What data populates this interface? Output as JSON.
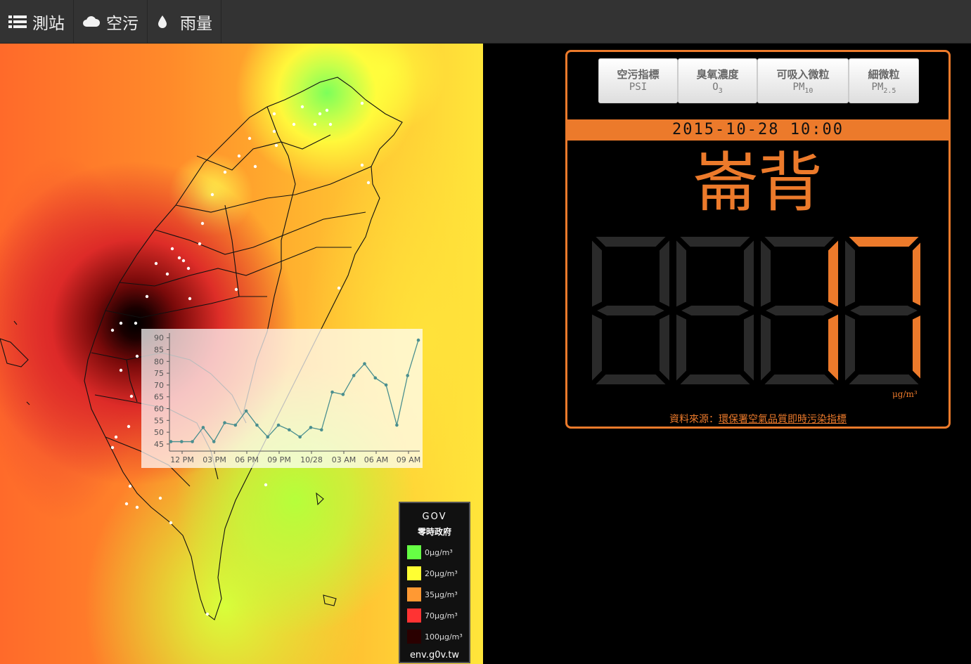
{
  "nav": {
    "items": [
      {
        "label": "測站",
        "icon": "list-icon"
      },
      {
        "label": "空污",
        "icon": "cloud-icon"
      },
      {
        "label": "雨量",
        "icon": "droplet-icon"
      }
    ]
  },
  "panel": {
    "tabs": [
      {
        "title": "空污指標",
        "code": "PSI",
        "sub": ""
      },
      {
        "title": "臭氧濃度",
        "code": "O",
        "sub": "3"
      },
      {
        "title": "可吸入微粒",
        "code": "PM",
        "sub": "10"
      },
      {
        "title": "細微粒",
        "code": "PM",
        "sub": "2.5"
      }
    ],
    "datetime": "2015-10-28 10:00",
    "station_name": "崙背",
    "value": "17",
    "unit": "μg/m³",
    "source_prefix": "資料來源：",
    "source_link": "環保署空氣品質即時污染指標",
    "accent_color": "#ec7a2b"
  },
  "legend": {
    "brand": "GOV",
    "brand_sub": "零時政府",
    "items": [
      {
        "label": "0μg/m³",
        "color": "#66ff44"
      },
      {
        "label": "20μg/m³",
        "color": "#ffff33"
      },
      {
        "label": "35μg/m³",
        "color": "#ff9933"
      },
      {
        "label": "70μg/m³",
        "color": "#ff3333"
      },
      {
        "label": "100μg/m³",
        "color": "#2a0000"
      }
    ],
    "footer": "env.g0v.tw"
  },
  "chart_data": {
    "type": "line",
    "x_ticks": [
      "12 PM",
      "03 PM",
      "06 PM",
      "09 PM",
      "10/28",
      "03 AM",
      "06 AM",
      "09 AM"
    ],
    "y_ticks": [
      45,
      50,
      55,
      60,
      65,
      70,
      75,
      80,
      85,
      90
    ],
    "ylim": [
      42,
      92
    ],
    "x_hours_from_start": [
      0,
      1,
      2,
      3,
      4,
      5,
      6,
      7,
      8,
      9,
      10,
      11,
      12,
      13,
      14,
      15,
      16,
      17,
      18,
      19,
      20,
      21,
      22,
      23,
      24
    ],
    "series": [
      {
        "values": [
          46,
          46,
          46,
          52,
          46,
          54,
          53,
          59,
          53,
          48,
          53,
          51,
          48,
          52,
          51,
          67,
          66,
          74,
          79,
          73,
          70,
          53,
          74,
          89
        ]
      }
    ],
    "xlabel": "",
    "ylabel": "",
    "grid": false,
    "line_color": "#4a8f8f"
  }
}
